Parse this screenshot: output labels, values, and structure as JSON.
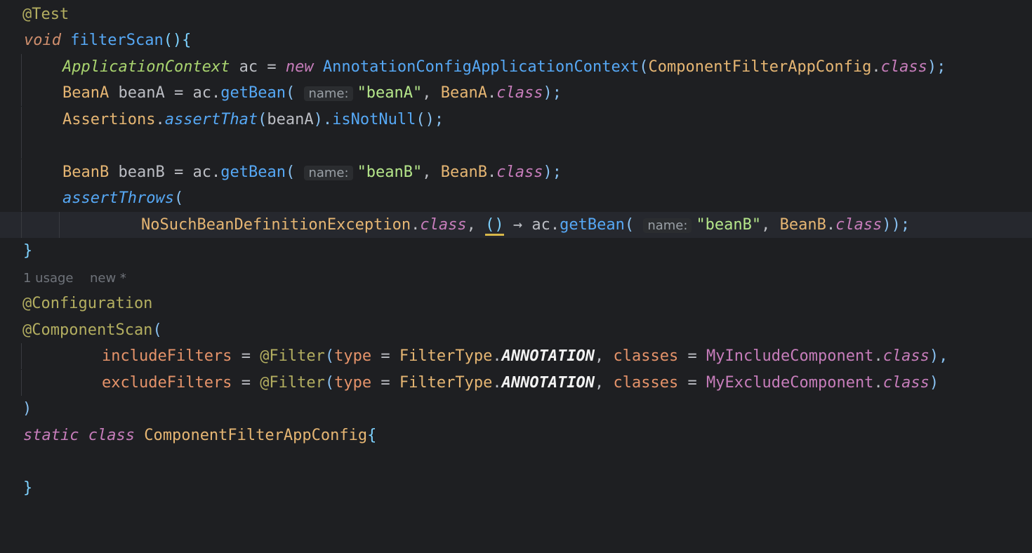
{
  "code": {
    "line1": "@Test",
    "line2_kw": "void",
    "line2_name": "filterScan",
    "line2_rest": "(){",
    "line3_a": "ApplicationContext",
    "line3_b": "ac",
    "line3_c": "=",
    "line3_d": "new",
    "line3_e": "AnnotationConfigApplicationContext",
    "line3_f": "(",
    "line3_g": "ComponentFilterAppConfig",
    "line3_h": ".",
    "line3_i": "class",
    "line3_j": ");",
    "line4_a": "BeanA",
    "line4_b": "beanA",
    "line4_c": "=",
    "line4_d": "ac.",
    "line4_e": "getBean",
    "line4_f": "(",
    "line4_hint": "name:",
    "line4_g": "\"beanA\"",
    "line4_h": ",",
    "line4_i": "BeanA",
    "line4_j": ".",
    "line4_k": "class",
    "line4_l": ");",
    "line5_a": "Assertions",
    "line5_b": ".",
    "line5_c": "assertThat",
    "line5_d": "(",
    "line5_e": "beanA",
    "line5_f": ").",
    "line5_g": "isNotNull",
    "line5_h": "();",
    "line7_a": "BeanB",
    "line7_b": "beanB",
    "line7_c": "=",
    "line7_d": "ac.",
    "line7_e": "getBean",
    "line7_f": "(",
    "line7_hint": "name:",
    "line7_g": "\"beanB\"",
    "line7_h": ",",
    "line7_i": "BeanB",
    "line7_j": ".",
    "line7_k": "class",
    "line7_l": ");",
    "line8_a": "assertThrows",
    "line8_b": "(",
    "line9_a": "NoSuchBeanDefinitionException",
    "line9_b": ".",
    "line9_c": "class",
    "line9_d": ",",
    "line9_e": "()",
    "line9_f": "→",
    "line9_g": "ac.",
    "line9_h": "getBean",
    "line9_i": "(",
    "line9_hint": "name:",
    "line9_j": "\"beanB\"",
    "line9_k": ",",
    "line9_l": "BeanB",
    "line9_m": ".",
    "line9_n": "class",
    "line9_o": "));",
    "line10": "}",
    "meta_usage": "1 usage",
    "meta_new": "new *",
    "line12": "@Configuration",
    "line13_a": "@ComponentScan",
    "line13_b": "(",
    "line14_a": "includeFilters",
    "line14_b": "=",
    "line14_c": "@Filter",
    "line14_d": "(",
    "line14_e": "type",
    "line14_f": "=",
    "line14_g": "FilterType",
    "line14_h": ".",
    "line14_i": "ANNOTATION",
    "line14_j": ",",
    "line14_k": "classes",
    "line14_l": "=",
    "line14_m": "MyIncludeComponent",
    "line14_n": ".",
    "line14_o": "class",
    "line14_p": "),",
    "line15_a": "excludeFilters",
    "line15_b": "=",
    "line15_c": "@Filter",
    "line15_d": "(",
    "line15_e": "type",
    "line15_f": "=",
    "line15_g": "FilterType",
    "line15_h": ".",
    "line15_i": "ANNOTATION",
    "line15_j": ",",
    "line15_k": "classes",
    "line15_l": "=",
    "line15_m": "MyExcludeComponent",
    "line15_n": ".",
    "line15_o": "class",
    "line15_p": ")",
    "line16": ")",
    "line17_a": "static",
    "line17_b": "class",
    "line17_c": "ComponentFilterAppConfig",
    "line17_d": "{",
    "line19": "}"
  }
}
